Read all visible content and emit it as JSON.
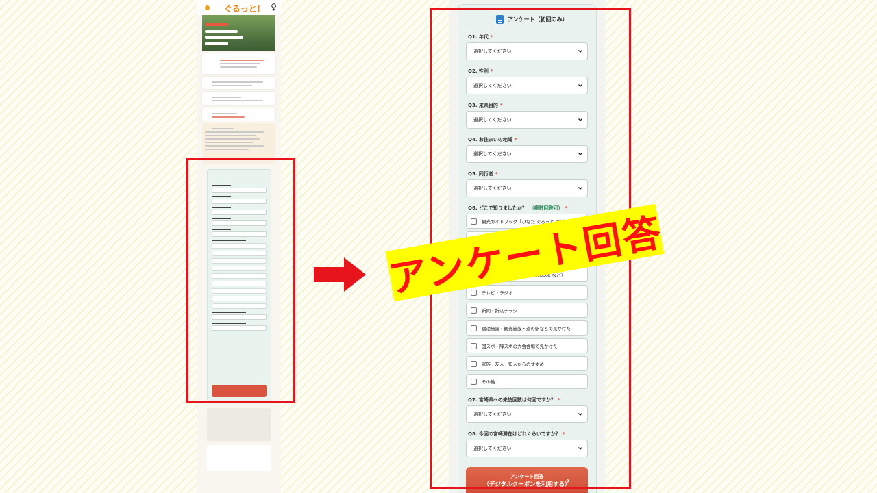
{
  "survey": {
    "title": "アンケート（初回のみ）",
    "required_mark": "*",
    "multi_note": "（複数回答可）",
    "q1_label": "Q1. 年代",
    "q2_label": "Q2. 性別",
    "q3_label": "Q3. 来県目的",
    "q4_label": "Q4. お住まいの地域",
    "q5_label": "Q5. 同行者",
    "q6_label": "Q6. どこで知りましたか？",
    "q7_label": "Q7. 宮崎県への来訪回数は何回ですか？",
    "q8_label": "Q8. 今回の宮崎滞在はどれくらいですか？",
    "select_placeholder": "選択してください",
    "q6_options": [
      "観光ガイドブック「ひなた ぐるっと 宮崎パスポート」（冊子",
      "",
      "SNS（Instagram・X・Facebook など）",
      "テレビ・ラジオ",
      "新聞・折込チラシ",
      "宿泊施設・観光施設・道の駅などで見かけた",
      "国スポ・障スポの大会会場で見かけた",
      "家族・友人・知人からのすすめ",
      "その他"
    ],
    "submit_line1": "アンケート回答",
    "submit_line2": "（デジタルクーポンを利用する）"
  },
  "thumbnail": {
    "logo": "ぐるっと!",
    "mascot": "♀"
  },
  "overlay": {
    "stamp_text": "アンケート回答"
  },
  "colors": {
    "highlight_frame": "#e8141b",
    "stamp_bg": "#ffff00",
    "stamp_text": "#ff1111",
    "submit_button": "#d9553f",
    "card_bg": "#e9f2ee",
    "survey_icon": "#2f7fc7"
  }
}
